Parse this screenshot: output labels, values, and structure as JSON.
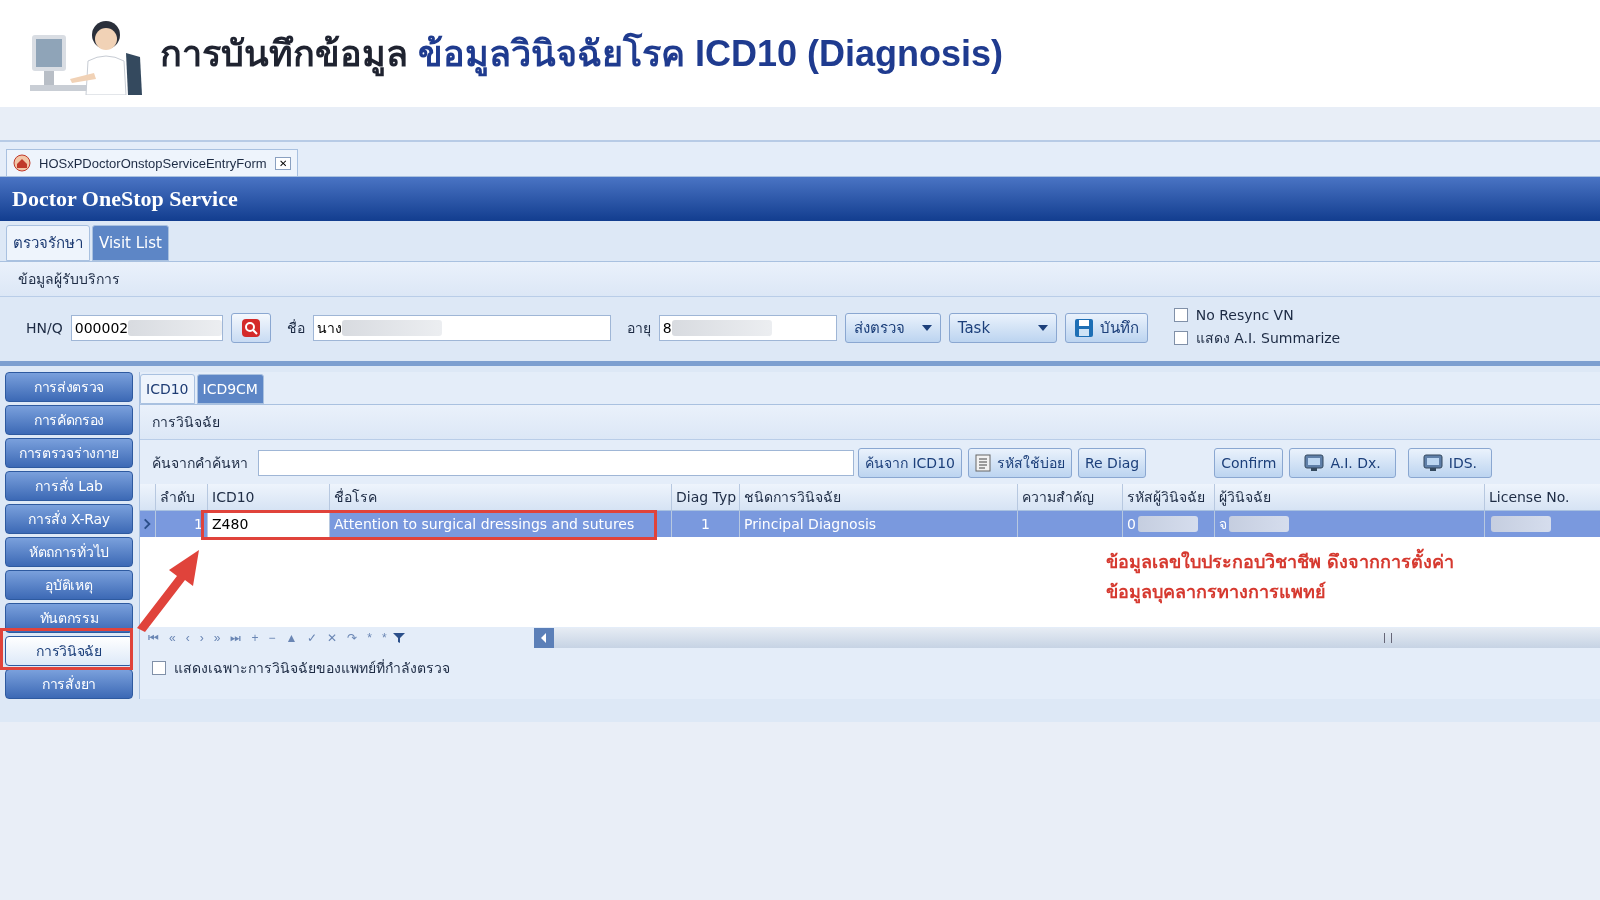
{
  "page_title": {
    "lead": "การบันทึกข้อมูล",
    "topic": "ข้อมูลวินิจฉัยโรค ICD10 (Diagnosis)"
  },
  "doc_tab": {
    "label": "HOSxPDoctorOnstopServiceEntryForm",
    "close": "✕"
  },
  "window": {
    "title": "Doctor OneStop Service"
  },
  "tabs": [
    {
      "label": "ตรวจรักษา",
      "selected": true
    },
    {
      "label": "Visit List",
      "selected": false
    }
  ],
  "patient": {
    "group_title": "ข้อมูลผู้รับบริการ",
    "fields": [
      {
        "label": "HN/Q",
        "value": "000002",
        "kind": "search"
      },
      {
        "label": "ชื่อ",
        "value": "นาง",
        "kind": "plain"
      },
      {
        "label": "อายุ",
        "value": "8",
        "kind": "plain"
      }
    ],
    "buttons": [
      {
        "label": "ส่งตรวจ",
        "kind": "dropdown"
      },
      {
        "label": "Task",
        "kind": "dropdown"
      },
      {
        "label": "บันทึก",
        "kind": "save"
      }
    ],
    "options": [
      {
        "label": "No Resync VN",
        "checked": false
      },
      {
        "label": "แสดง A.I. Summarize",
        "checked": false
      }
    ]
  },
  "sidebar": {
    "items": [
      {
        "label": "การส่งตรวจ",
        "selected": false
      },
      {
        "label": "การคัดกรอง",
        "selected": false
      },
      {
        "label": "การตรวจร่างกาย",
        "selected": false
      },
      {
        "label": "การสั่ง Lab",
        "selected": false
      },
      {
        "label": "การสั่ง X-Ray",
        "selected": false
      },
      {
        "label": "หัตถการทั่วไป",
        "selected": false
      },
      {
        "label": "อุบัติเหตุ",
        "selected": false
      },
      {
        "label": "ทันตกรรม",
        "selected": false
      },
      {
        "label": "การวินิจฉัย",
        "selected": true
      },
      {
        "label": "การสั่งยา",
        "selected": false
      }
    ]
  },
  "code_tabs": [
    {
      "label": "ICD10",
      "selected": true
    },
    {
      "label": "ICD9CM",
      "selected": false
    }
  ],
  "diagnosis": {
    "group_title": "การวินิจฉัย",
    "search_label": "ค้นจากคำค้นหา",
    "buttons": [
      {
        "label": "ค้นจาก ICD10",
        "kind": "plain"
      },
      {
        "label": "รหัสใช้บ่อย",
        "kind": "list"
      },
      {
        "label": "Re Diag",
        "kind": "plain"
      },
      {
        "label": "Confirm",
        "kind": "plain"
      },
      {
        "label": "A.I. Dx.",
        "kind": "monitor"
      },
      {
        "label": "IDS.",
        "kind": "monitor"
      }
    ],
    "table": {
      "columns": [
        "ลำดับ",
        "ICD10",
        "ชื่อโรค",
        "Diag Typ",
        "ชนิดการวินิจฉัย",
        "ความสำคัญ",
        "รหัสผู้วินิจฉัย",
        "ผู้วินิจฉัย",
        "License No."
      ],
      "rows": [
        {
          "selected": true,
          "cells": [
            "1",
            "Z480",
            "Attention to surgical dressings and sutures",
            "1",
            "Principal Diagnosis",
            "",
            "0",
            "จ",
            ""
          ]
        }
      ]
    },
    "annotation": [
      "ข้อมูลเลขใบประกอบวิชาชีพ ดึงจากการตั้งค่า",
      "ข้อมูลบุคลากรทางการแพทย์"
    ],
    "nav_buttons": [
      "⏮",
      "«",
      "‹",
      "›",
      "»",
      "⏭",
      "+",
      "−",
      "▲",
      "✓",
      "✕",
      "↷",
      "*",
      "*"
    ],
    "own_only": {
      "label": "แสดงเฉพาะการวินิจฉัยของแพทย์ที่กำลังตรวจ",
      "checked": false
    }
  }
}
